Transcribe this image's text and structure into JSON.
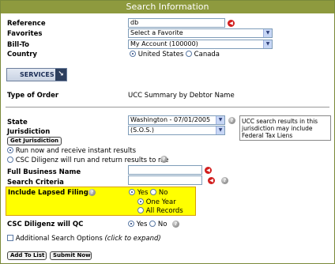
{
  "window": {
    "title": "Search Information"
  },
  "reference": {
    "label": "Reference",
    "value": "db"
  },
  "favorites": {
    "label": "Favorites",
    "selected": "Select a Favorite"
  },
  "bill_to": {
    "label": "Bill-To",
    "selected": "My Account (100000)"
  },
  "country": {
    "label": "Country",
    "options": [
      "United States",
      "Canada"
    ],
    "selected": "United States"
  },
  "services_button": {
    "label": "SERVICES"
  },
  "type_of_order": {
    "label": "Type of Order",
    "value": "UCC Summary by Debtor Name"
  },
  "state": {
    "label": "State",
    "selected": "Washington - 07/01/2005"
  },
  "jurisdiction": {
    "label": "Jurisdiction",
    "selected": "(S.O.S.)",
    "button": "Get Jurisdiction"
  },
  "note": {
    "text": "UCC search results in this jurisdiction may include Federal Tax Liens"
  },
  "run_options": {
    "instant": "Run now and receive instant results",
    "diligenz": "CSC Diligenz will run and return results to me",
    "selected": "instant"
  },
  "full_business_name": {
    "label": "Full Business Name",
    "value": ""
  },
  "search_criteria": {
    "label": "Search Criteria",
    "value": ""
  },
  "include_lapsed": {
    "label": "Include Lapsed Filings",
    "yes": "Yes",
    "no": "No",
    "selected": "Yes",
    "sub_options": [
      "One Year",
      "All Records"
    ],
    "sub_selected": "One Year",
    "highlight_color": "#ffff00"
  },
  "diligenz_qc": {
    "label": "CSC Diligenz will QC",
    "yes": "Yes",
    "no": "No",
    "selected": "Yes"
  },
  "additional_search": {
    "label": "Additional Search Options",
    "hint": "(click to expand)",
    "checked": false
  },
  "buttons": {
    "add_to_list": "Add To List",
    "submit_now": "Submit Now"
  },
  "colors": {
    "title_bar": "#8e9a3e",
    "error_icon": "#d21e1e"
  }
}
